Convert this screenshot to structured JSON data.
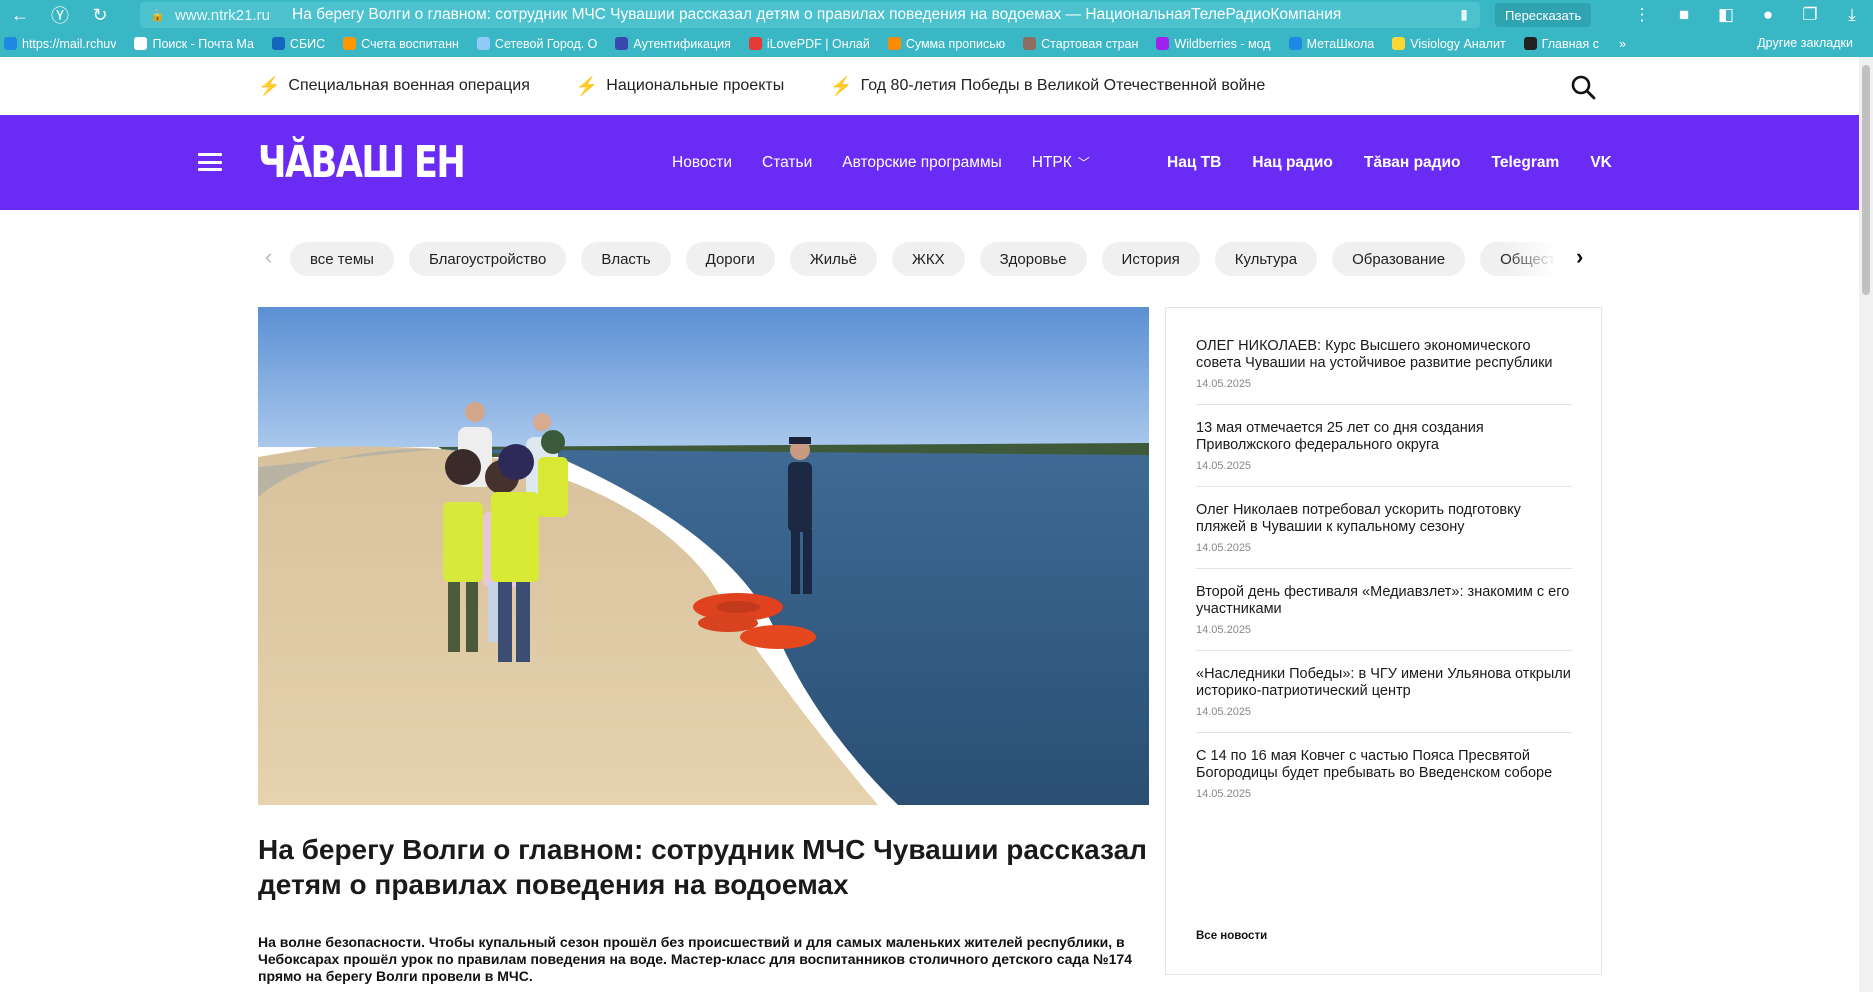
{
  "browser": {
    "domain": "www.ntrk21.ru",
    "tab_title": "На берегу Волги о главном: сотрудник МЧС Чувашии рассказал детям о правилах поведения на водоемах — НациональнаяТелеРадиоКомпания",
    "retell_label": "Пересказать",
    "bookmarks": [
      {
        "label": "https://mail.rchuv",
        "color": "#1e88e5"
      },
      {
        "label": "Поиск - Почта Ма",
        "color": "#ffffff"
      },
      {
        "label": "СБИС",
        "color": "#1565c0"
      },
      {
        "label": "Счета воспитанн",
        "color": "#ff9800"
      },
      {
        "label": "Сетевой Город. О",
        "color": "#90caf9"
      },
      {
        "label": "Аутентификация",
        "color": "#3949ab"
      },
      {
        "label": "iLovePDF | Онлай",
        "color": "#e53935"
      },
      {
        "label": "Сумма прописью",
        "color": "#fb8c00"
      },
      {
        "label": "Стартовая стран",
        "color": "#8d6e63"
      },
      {
        "label": "Wildberries - мод",
        "color": "#a020f0"
      },
      {
        "label": "МетаШкола",
        "color": "#1e88e5"
      },
      {
        "label": "Visiology Аналит",
        "color": "#fdd835"
      },
      {
        "label": "Главная с",
        "color": "#212121"
      }
    ],
    "bookmarks_more": "»",
    "other_bookmarks": "Другие закладки"
  },
  "topics": [
    "Специальная военная операция",
    "Национальные проекты",
    "Год 80-летия Победы в Великой Отечественной войне"
  ],
  "header": {
    "logo": "ЧĂВАШ ЕН",
    "nav": [
      "Новости",
      "Статьи",
      "Авторские программы",
      "НТРК"
    ],
    "media": [
      "Нац ТВ",
      "Нац радио",
      "Тăван радио",
      "Telegram",
      "VK"
    ]
  },
  "tags": [
    "все темы",
    "Благоустройство",
    "Власть",
    "Дороги",
    "Жильё",
    "ЖКХ",
    "Здоровье",
    "История",
    "Культура",
    "Образование",
    "Общество"
  ],
  "article": {
    "headline": "На берегу Волги о главном: сотрудник МЧС Чувашии рассказал детям о правилах поведения на водоемах",
    "lead": "На волне безопасности. Чтобы купальный сезон прошёл без происшествий и для самых маленьких жителей республики, в Чебоксарах прошёл урок по правилам поведения на воде. Мастер-класс для воспитанников столичного детского сада №174 прямо на берегу Волги провели в МЧС."
  },
  "sidebar": {
    "news": [
      {
        "title": "ОЛЕГ НИКОЛАЕВ: Курс Высшего экономического совета Чувашии на устойчивое развитие республики",
        "date": "14.05.2025"
      },
      {
        "title": "13 мая отмечается 25 лет со дня создания Приволжского федерального округа",
        "date": "14.05.2025"
      },
      {
        "title": "Олег Николаев потребовал ускорить подготовку пляжей в Чувашии к купальному сезону",
        "date": "14.05.2025"
      },
      {
        "title": "Второй день фестиваля «Медиавзлет»: знакомим с его участниками",
        "date": "14.05.2025"
      },
      {
        "title": "«Наследники Победы»: в ЧГУ имени Ульянова открыли историко-патриотический центр",
        "date": "14.05.2025"
      },
      {
        "title": "С 14 по 16 мая Ковчег с частью Пояса Пресвятой Богородицы будет пребывать во Введенском соборе",
        "date": "14.05.2025"
      }
    ],
    "all_news": "Все новости"
  },
  "colors": {
    "chrome": "#3ab7c4",
    "brand_purple": "#6a2cf5",
    "bolt": "#ff6a1a"
  }
}
